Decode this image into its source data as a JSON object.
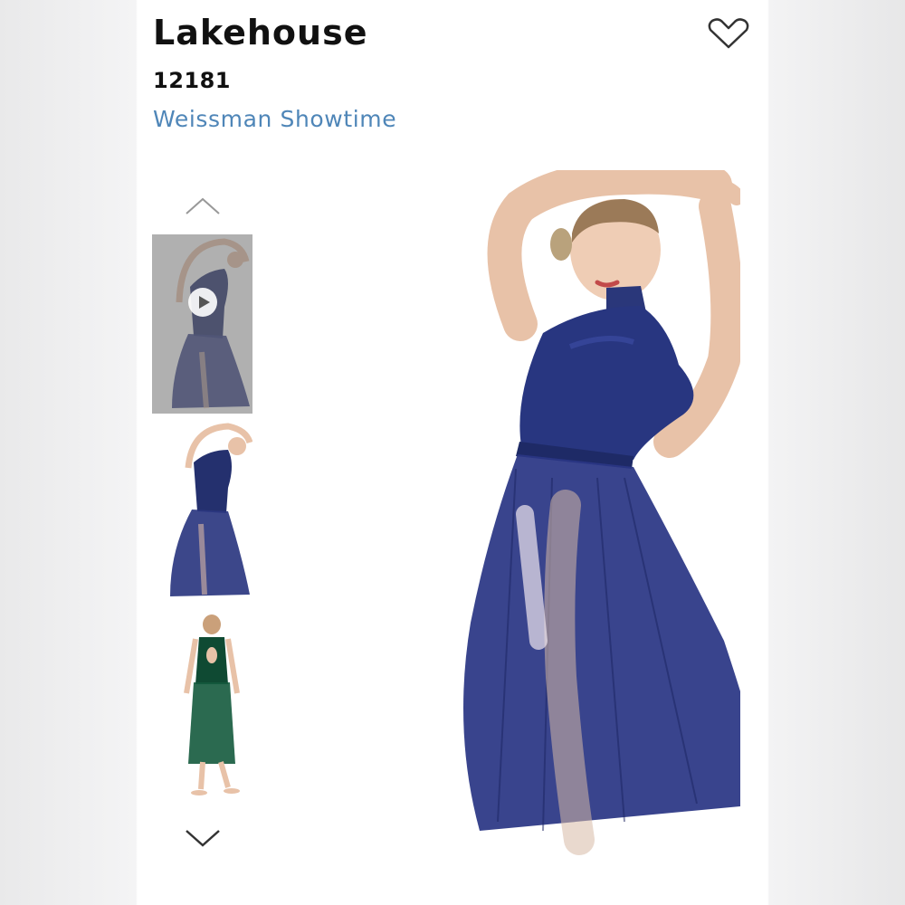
{
  "product": {
    "title": "Lakehouse",
    "sku": "12181",
    "brand": "Weissman Showtime"
  },
  "gallery": {
    "thumbnails": [
      {
        "label": "video-thumbnail",
        "has_play_icon": true,
        "dress_color": "#24306e"
      },
      {
        "label": "image-thumbnail",
        "has_play_icon": false,
        "dress_color": "#24306e"
      },
      {
        "label": "image-thumbnail",
        "has_play_icon": false,
        "dress_color": "#0f4a33"
      }
    ],
    "main_dress_color": "#24306e"
  },
  "colors": {
    "title": "#111111",
    "brand_link": "#4f86b8",
    "icon_stroke": "#333333",
    "navy": "#24306e",
    "green": "#0f4a33",
    "skin": "#e8c2a8"
  },
  "icons": {
    "favorite": "heart-outline-icon",
    "scroll_up": "chevron-up-icon",
    "scroll_down": "chevron-down-icon",
    "play": "play-icon"
  }
}
